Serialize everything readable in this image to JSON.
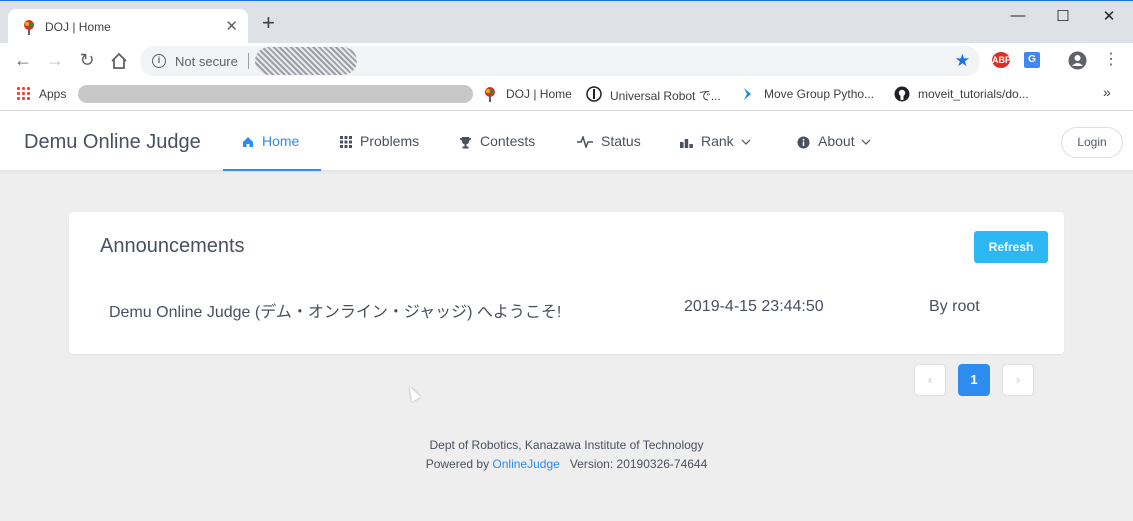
{
  "browser": {
    "tab_title": "DOJ | Home",
    "tab_close": "✕",
    "new_tab": "+",
    "window_controls": [
      "—",
      "☐",
      "✕"
    ],
    "security_label": "Not secure",
    "bookmarks": [
      {
        "label": "Apps"
      },
      {
        "label": "DOJ | Home"
      },
      {
        "label": "Universal Robot で..."
      },
      {
        "label": "Move Group Pytho..."
      },
      {
        "label": "moveit_tutorials/do..."
      }
    ],
    "bookmarks_more": "»",
    "extensions": {
      "abp": "ABP",
      "translate": "G"
    }
  },
  "app": {
    "logo": "Demu Online Judge",
    "menu": [
      {
        "label": "Home",
        "icon": "home-icon",
        "active": true
      },
      {
        "label": "Problems",
        "icon": "grid-icon"
      },
      {
        "label": "Contests",
        "icon": "trophy-icon"
      },
      {
        "label": "Status",
        "icon": "pulse-icon"
      },
      {
        "label": "Rank",
        "icon": "bar-chart-icon"
      },
      {
        "label": "About",
        "icon": "info-icon"
      }
    ],
    "login_label": "Login"
  },
  "announcements": {
    "title": "Announcements",
    "refresh_label": "Refresh",
    "items": [
      {
        "title": "Demu Online Judge (デム・オンライン・ジャッジ) へようこそ!",
        "date": "2019-4-15 23:44:50",
        "author": "By root"
      }
    ],
    "pagination": {
      "prev": "‹",
      "current": "1",
      "next": "›"
    }
  },
  "footer": {
    "line1": "Dept of Robotics, Kanazawa Institute of Technology",
    "powered_by": "Powered by",
    "oj_link": "OnlineJudge",
    "version": "Version: 20190326-74644"
  },
  "colors": {
    "accent": "#2d8cf0",
    "refresh": "#2db7f5",
    "background": "#eeeeee"
  }
}
